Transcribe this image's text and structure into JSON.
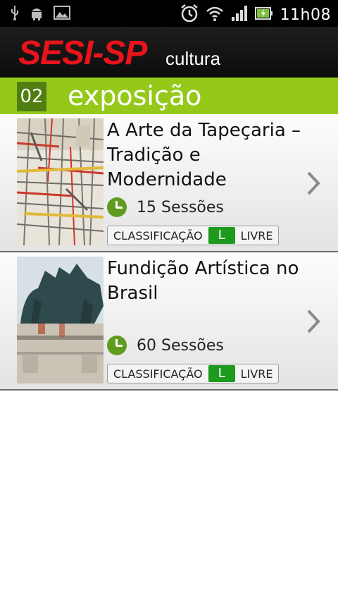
{
  "status_bar": {
    "left_icons": [
      "usb-icon",
      "android-icon",
      "image-icon"
    ],
    "right_icons": [
      "alarm-icon",
      "wifi-icon",
      "signal-icon",
      "battery-icon"
    ],
    "time": "11h08"
  },
  "header": {
    "brand": "SESI-SP",
    "brand_sub": "cultura",
    "brand_color": "#e8141c"
  },
  "section": {
    "number": "02",
    "title": "exposição",
    "color": "#94c91a"
  },
  "items": [
    {
      "title": "A Arte da Tapeçaria – Tradição e Modernidade",
      "sessions": "15 Sessões",
      "rating_label": "CLASSIFICAÇÃO",
      "rating_code": "L",
      "rating_text": "LIVRE"
    },
    {
      "title": "Fundição Artística no Brasil",
      "sessions": "60 Sessões",
      "rating_label": "CLASSIFICAÇÃO",
      "rating_code": "L",
      "rating_text": "LIVRE"
    }
  ]
}
